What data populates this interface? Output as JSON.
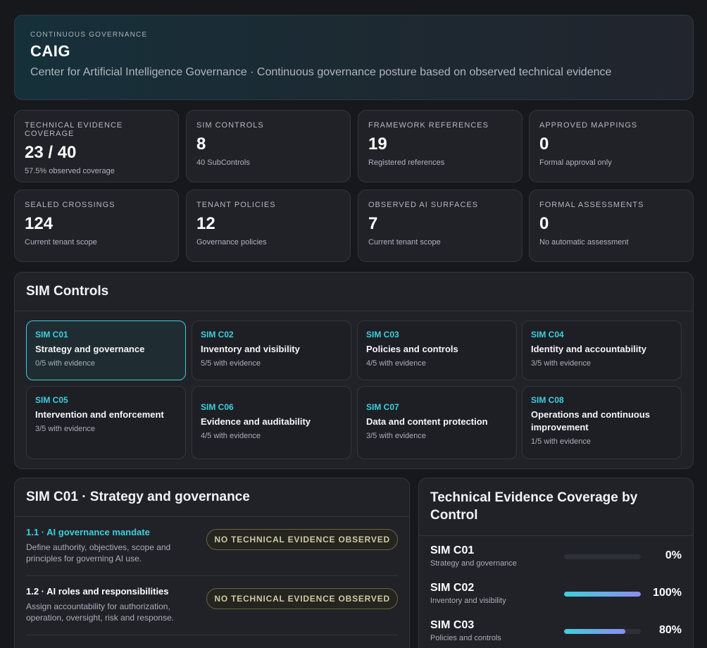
{
  "header": {
    "eyebrow": "CONTINUOUS GOVERNANCE",
    "title": "CAIG",
    "subtitle": "Center for Artificial Intelligence Governance · Continuous governance posture based on observed technical evidence"
  },
  "metrics": [
    {
      "label": "TECHNICAL EVIDENCE COVERAGE",
      "value": "23 / 40",
      "note": "57.5% observed coverage"
    },
    {
      "label": "SIM CONTROLS",
      "value": "8",
      "note": "40 SubControls"
    },
    {
      "label": "FRAMEWORK REFERENCES",
      "value": "19",
      "note": "Registered references"
    },
    {
      "label": "APPROVED MAPPINGS",
      "value": "0",
      "note": "Formal approval only"
    },
    {
      "label": "SEALED CROSSINGS",
      "value": "124",
      "note": "Current tenant scope"
    },
    {
      "label": "TENANT POLICIES",
      "value": "12",
      "note": "Governance policies"
    },
    {
      "label": "OBSERVED AI SURFACES",
      "value": "7",
      "note": "Current tenant scope"
    },
    {
      "label": "FORMAL ASSESSMENTS",
      "value": "0",
      "note": "No automatic assessment"
    }
  ],
  "controls": {
    "title": "SIM Controls",
    "items": [
      {
        "code": "SIM C01",
        "name": "Strategy and governance",
        "evidence": "0/5 with evidence"
      },
      {
        "code": "SIM C02",
        "name": "Inventory and visibility",
        "evidence": "5/5 with evidence"
      },
      {
        "code": "SIM C03",
        "name": "Policies and controls",
        "evidence": "4/5 with evidence"
      },
      {
        "code": "SIM C04",
        "name": "Identity and accountability",
        "evidence": "3/5 with evidence"
      },
      {
        "code": "SIM C05",
        "name": "Intervention and enforcement",
        "evidence": "3/5 with evidence"
      },
      {
        "code": "SIM C06",
        "name": "Evidence and auditability",
        "evidence": "4/5 with evidence"
      },
      {
        "code": "SIM C07",
        "name": "Data and content protection",
        "evidence": "3/5 with evidence"
      },
      {
        "code": "SIM C08",
        "name": "Operations and continuous improvement",
        "evidence": "1/5 with evidence"
      }
    ]
  },
  "detail": {
    "title": "SIM C01 · Strategy and governance",
    "subcontrols": [
      {
        "title": "1.1 · AI governance mandate",
        "desc": "Define authority, objectives, scope and principles for governing AI use.",
        "status": "NO TECHNICAL EVIDENCE OBSERVED"
      },
      {
        "title": "1.2 · AI roles and responsibilities",
        "desc": "Assign accountability for authorization, operation, oversight, risk and response.",
        "status": "NO TECHNICAL EVIDENCE OBSERVED"
      }
    ]
  },
  "coverage": {
    "title": "Technical Evidence Coverage by Control",
    "rows": [
      {
        "code": "SIM C01",
        "name": "Strategy and governance",
        "pct": "0%",
        "value": 0
      },
      {
        "code": "SIM C02",
        "name": "Inventory and visibility",
        "pct": "100%",
        "value": 1.0
      },
      {
        "code": "SIM C03",
        "name": "Policies and controls",
        "pct": "80%",
        "value": 0.8
      }
    ]
  }
}
